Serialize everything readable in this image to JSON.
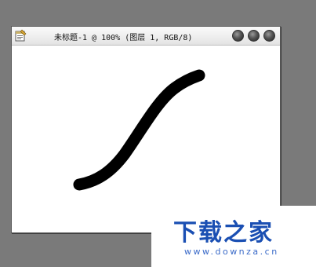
{
  "window": {
    "title": "未标题-1 @ 100% (图层 1, RGB/8)",
    "icons": {
      "app": "document-icon"
    },
    "buttons": [
      "minimize-button",
      "maximize-button",
      "close-button"
    ]
  },
  "canvas": {
    "stroke_color": "#000000",
    "background": "#ffffff"
  },
  "watermark": {
    "logo_text": "下载之家",
    "url": "www.downza.cn",
    "color": "#1a4fb3"
  }
}
